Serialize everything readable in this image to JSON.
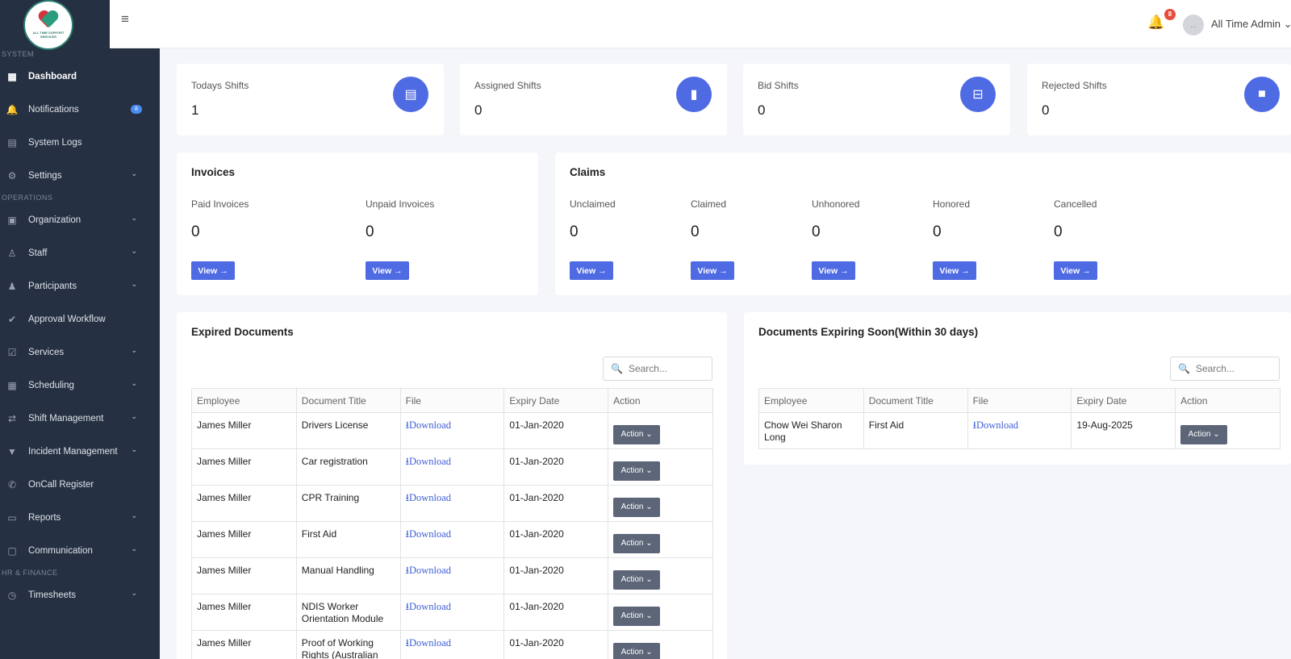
{
  "brand": {
    "logo_text": "ALL TIME SUPPORT SERVICES"
  },
  "sidebar": {
    "sections": [
      {
        "title": "SYSTEM",
        "items": [
          {
            "label": "Dashboard",
            "icon": "grid-icon",
            "glyph": "▦",
            "active": true
          },
          {
            "label": "Notifications",
            "icon": "bell-icon",
            "glyph": "🔔",
            "badge": "8"
          },
          {
            "label": "System Logs",
            "icon": "file-icon",
            "glyph": "▤"
          },
          {
            "label": "Settings",
            "icon": "gear-icon",
            "glyph": "⚙",
            "chevron": true
          }
        ]
      },
      {
        "title": "OPERATIONS",
        "items": [
          {
            "label": "Organization",
            "icon": "building-icon",
            "glyph": "▣",
            "chevron": true
          },
          {
            "label": "Staff",
            "icon": "user-icon",
            "glyph": "♙",
            "chevron": true
          },
          {
            "label": "Participants",
            "icon": "users-icon",
            "glyph": "♟",
            "chevron": true
          },
          {
            "label": "Approval Workflow",
            "icon": "check-circle-icon",
            "glyph": "✔"
          },
          {
            "label": "Services",
            "icon": "clipboard-icon",
            "glyph": "☑",
            "chevron": true
          },
          {
            "label": "Scheduling",
            "icon": "calendar-icon",
            "glyph": "▦",
            "chevron": true
          },
          {
            "label": "Shift Management",
            "icon": "swap-icon",
            "glyph": "⇄",
            "chevron": true
          },
          {
            "label": "Incident Management",
            "icon": "filter-icon",
            "glyph": "▼",
            "chevron": true
          },
          {
            "label": "OnCall Register",
            "icon": "phone-icon",
            "glyph": "✆"
          },
          {
            "label": "Reports",
            "icon": "report-icon",
            "glyph": "▭",
            "chevron": true
          },
          {
            "label": "Communication",
            "icon": "chat-icon",
            "glyph": "▢",
            "chevron": true
          }
        ]
      },
      {
        "title": "HR & FINANCE",
        "items": [
          {
            "label": "Timesheets",
            "icon": "clock-icon",
            "glyph": "◷",
            "chevron": true
          }
        ]
      }
    ]
  },
  "topbar": {
    "notification_count": "8",
    "user_initials": "...",
    "user_name": "All Time Admin ⌄"
  },
  "stats": [
    {
      "label": "Todays Shifts",
      "value": "1",
      "icon": "document-icon",
      "glyph": "▤"
    },
    {
      "label": "Assigned Shifts",
      "value": "0",
      "icon": "file-icon",
      "glyph": "▮"
    },
    {
      "label": "Bid Shifts",
      "value": "0",
      "icon": "briefcase-icon",
      "glyph": "⊟"
    },
    {
      "label": "Rejected Shifts",
      "value": "0",
      "icon": "stop-icon",
      "glyph": "■"
    }
  ],
  "invoices": {
    "title": "Invoices",
    "items": [
      {
        "label": "Paid Invoices",
        "value": "0",
        "button": "View →"
      },
      {
        "label": "Unpaid Invoices",
        "value": "0",
        "button": "View →"
      }
    ]
  },
  "claims": {
    "title": "Claims",
    "items": [
      {
        "label": "Unclaimed",
        "value": "0",
        "button": "View →"
      },
      {
        "label": "Claimed",
        "value": "0",
        "button": "View →"
      },
      {
        "label": "Unhonored",
        "value": "0",
        "button": "View →"
      },
      {
        "label": "Honored",
        "value": "0",
        "button": "View →"
      },
      {
        "label": "Cancelled",
        "value": "0",
        "button": "View →"
      }
    ]
  },
  "expired_docs": {
    "title": "Expired Documents",
    "search_placeholder": "Search...",
    "columns": [
      "Employee",
      "Document Title",
      "File",
      "Expiry Date",
      "Action"
    ],
    "rows": [
      {
        "employee": "James Miller",
        "title": "Drivers License",
        "file": "⭳Download",
        "expiry": "01-Jan-2020",
        "action": "Action ⌄"
      },
      {
        "employee": "James Miller",
        "title": "Car registration",
        "file": "⭳Download",
        "expiry": "01-Jan-2020",
        "action": "Action ⌄"
      },
      {
        "employee": "James Miller",
        "title": "CPR Training",
        "file": "⭳Download",
        "expiry": "01-Jan-2020",
        "action": "Action ⌄"
      },
      {
        "employee": "James Miller",
        "title": "First Aid",
        "file": "⭳Download",
        "expiry": "01-Jan-2020",
        "action": "Action ⌄"
      },
      {
        "employee": "James Miller",
        "title": "Manual Handling",
        "file": "⭳Download",
        "expiry": "01-Jan-2020",
        "action": "Action ⌄"
      },
      {
        "employee": "James Miller",
        "title": "NDIS Worker Orientation Module",
        "file": "⭳Download",
        "expiry": "01-Jan-2020",
        "action": "Action ⌄"
      },
      {
        "employee": "James Miller",
        "title": "Proof of Working Rights (Australian",
        "file": "⭳Download",
        "expiry": "01-Jan-2020",
        "action": "Action ⌄"
      }
    ]
  },
  "expiring_docs": {
    "title": "Documents Expiring Soon(Within 30 days)",
    "search_placeholder": "Search...",
    "columns": [
      "Employee",
      "Document Title",
      "File",
      "Expiry Date",
      "Action"
    ],
    "rows": [
      {
        "employee": "Chow Wei Sharon Long",
        "title": "First Aid",
        "file": "⭳Download",
        "expiry": "19-Aug-2025",
        "action": "Action ⌄"
      }
    ]
  }
}
